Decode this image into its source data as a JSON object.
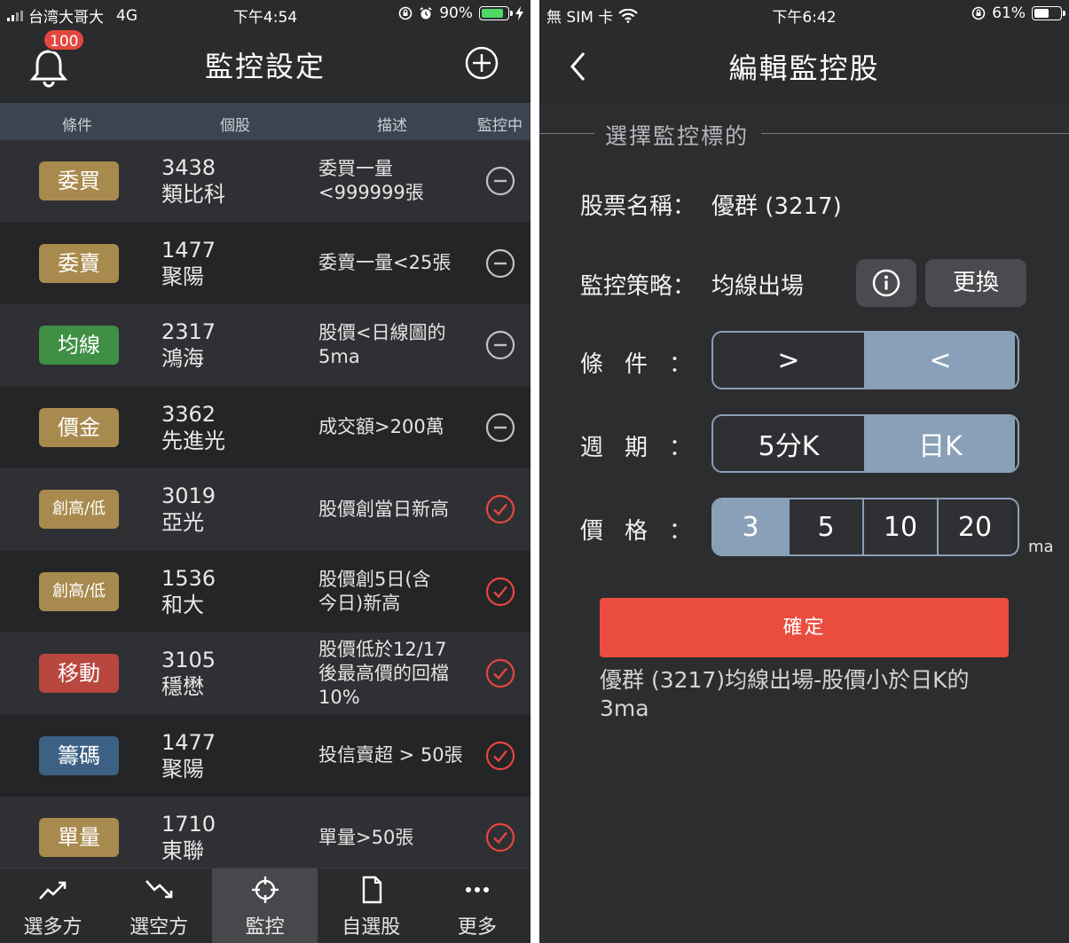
{
  "left": {
    "status": {
      "carrier": "台湾大哥大",
      "network": "4G",
      "time": "下午4:54",
      "battery": "90%",
      "battery_level": 0.9,
      "battery_color": "#4cd964"
    },
    "header": {
      "title": "監控設定",
      "badge": "100"
    },
    "columns": [
      "條件",
      "個股",
      "描述",
      "監控中"
    ],
    "rows": [
      {
        "tag": "委買",
        "tag_color": "#a98a4e",
        "code": "3438",
        "name": "類比科",
        "desc": "委買一量\n<999999張",
        "monitoring": false
      },
      {
        "tag": "委賣",
        "tag_color": "#a98a4e",
        "code": "1477",
        "name": "聚陽",
        "desc": "委賣一量<25張",
        "monitoring": false
      },
      {
        "tag": "均線",
        "tag_color": "#3f8f45",
        "code": "2317",
        "name": "鴻海",
        "desc": "股價<日線圖的\n5ma",
        "monitoring": false
      },
      {
        "tag": "價金",
        "tag_color": "#a98a4e",
        "code": "3362",
        "name": "先進光",
        "desc": "成交額>200萬",
        "monitoring": false
      },
      {
        "tag": "創高/低",
        "tag_color": "#a98a4e",
        "code": "3019",
        "name": "亞光",
        "desc": "股價創當日新高",
        "monitoring": true
      },
      {
        "tag": "創高/低",
        "tag_color": "#a98a4e",
        "code": "1536",
        "name": "和大",
        "desc": "股價創5日(含\n今日)新高",
        "monitoring": true
      },
      {
        "tag": "移動",
        "tag_color": "#b8473f",
        "code": "3105",
        "name": "穩懋",
        "desc": "股價低於12/17\n後最高價的回檔\n10%",
        "monitoring": true
      },
      {
        "tag": "籌碼",
        "tag_color": "#3c6184",
        "code": "1477",
        "name": "聚陽",
        "desc": "投信賣超 > 50張",
        "monitoring": true
      },
      {
        "tag": "單量",
        "tag_color": "#a98a4e",
        "code": "1710",
        "name": "東聯",
        "desc": "單量>50張",
        "monitoring": true
      }
    ],
    "tabs": [
      {
        "label": "選多方",
        "icon": "trend-up-icon",
        "active": false
      },
      {
        "label": "選空方",
        "icon": "trend-down-icon",
        "active": false
      },
      {
        "label": "監控",
        "icon": "crosshair-icon",
        "active": true
      },
      {
        "label": "自選股",
        "icon": "document-icon",
        "active": false
      },
      {
        "label": "更多",
        "icon": "more-icon",
        "active": false
      }
    ],
    "colors": {
      "monitor_on": "#e5463e",
      "monitor_off": "#bfc1c4"
    }
  },
  "right": {
    "status": {
      "carrier": "無 SIM 卡",
      "time": "下午6:42",
      "battery": "61%",
      "battery_level": 0.61,
      "battery_color": "#ffffff"
    },
    "header": {
      "title": "編輯監控股"
    },
    "section_title": "選擇監控標的",
    "stock_label": "股票名稱：",
    "stock_value": "優群 (3217)",
    "strategy_label": "監控策略：",
    "strategy_value": "均線出場",
    "change_label": "更換",
    "condition_label": [
      "條",
      "件",
      "："
    ],
    "condition_options": [
      {
        "label": ">",
        "selected": false
      },
      {
        "label": "<",
        "selected": true
      }
    ],
    "period_label": [
      "週",
      "期",
      "："
    ],
    "period_options": [
      {
        "label": "5分K",
        "selected": false
      },
      {
        "label": "日K",
        "selected": true
      }
    ],
    "price_label": [
      "價",
      "格",
      "："
    ],
    "price_options": [
      {
        "label": "3",
        "selected": true
      },
      {
        "label": "5",
        "selected": false
      },
      {
        "label": "10",
        "selected": false
      },
      {
        "label": "20",
        "selected": false
      }
    ],
    "price_unit": "ma",
    "confirm_label": "確定",
    "summary": "優群 (3217)均線出場-股價小於日K的3ma"
  }
}
